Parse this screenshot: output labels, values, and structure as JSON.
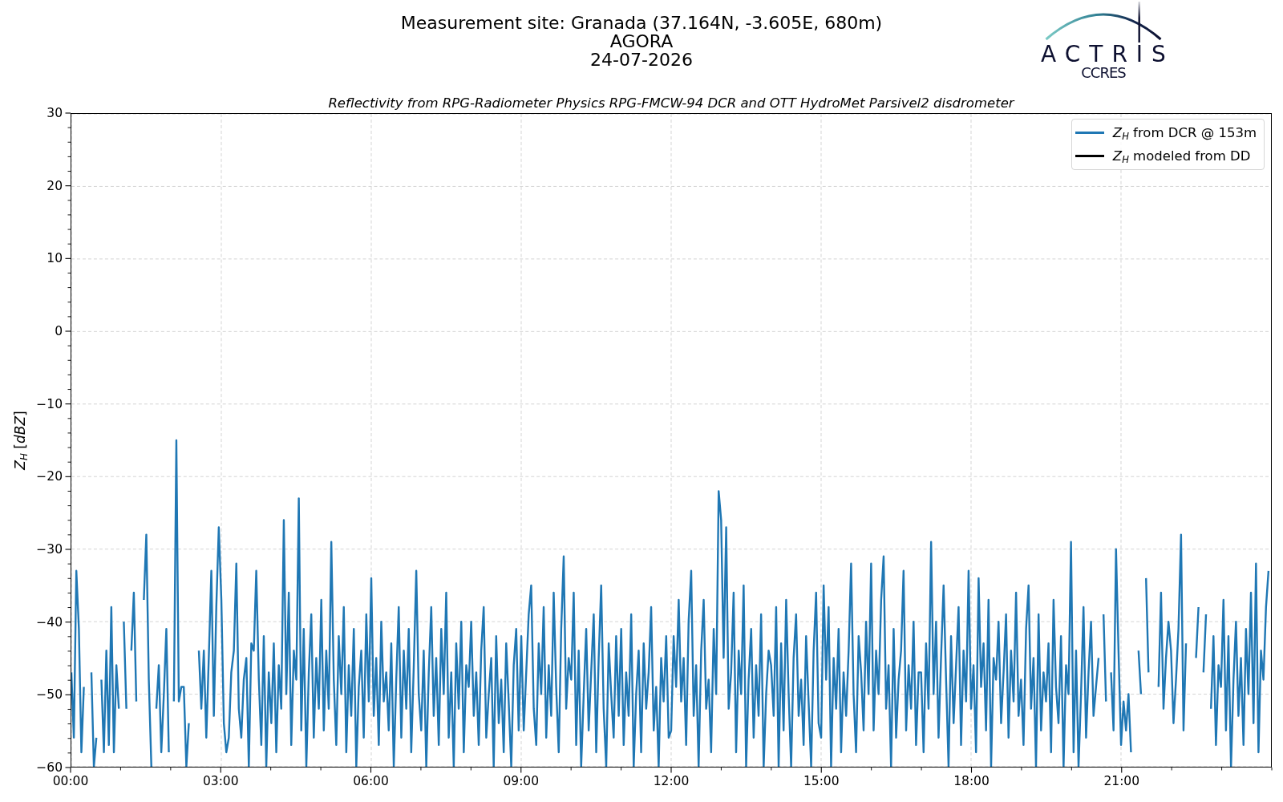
{
  "header": {
    "title": "Measurement site: Granada (37.164N, -3.605E, 680m)",
    "station": "AGORA",
    "date": "24-07-2026"
  },
  "logo": {
    "wordmark": "ACTRIS",
    "subtitle": "CCRES"
  },
  "chart": {
    "chart_data": {
      "type": "line",
      "title": "Reflectivity from RPG-Radiometer Physics RPG-FMCW-94 DCR and OTT HydroMet Parsivel2 disdrometer",
      "ylabel": "*Z*$_{H}$ [*dBZ*]",
      "grid": true,
      "xlim": [
        0,
        1440
      ],
      "ylim": [
        -60,
        30
      ],
      "xticks": [
        {
          "value": 0,
          "label": "00:00"
        },
        {
          "value": 180,
          "label": "03:00"
        },
        {
          "value": 360,
          "label": "06:00"
        },
        {
          "value": 540,
          "label": "09:00"
        },
        {
          "value": 720,
          "label": "12:00"
        },
        {
          "value": 900,
          "label": "15:00"
        },
        {
          "value": 1080,
          "label": "18:00"
        },
        {
          "value": 1260,
          "label": "21:00"
        }
      ],
      "yticks": [
        {
          "value": -60,
          "label": "−60"
        },
        {
          "value": -50,
          "label": "−50"
        },
        {
          "value": -40,
          "label": "−40"
        },
        {
          "value": -30,
          "label": "−30"
        },
        {
          "value": -20,
          "label": "−20"
        },
        {
          "value": -10,
          "label": "−10"
        },
        0,
        10,
        20,
        30
      ],
      "x": [
        0,
        3,
        6,
        9,
        12,
        15,
        24,
        27,
        30,
        36,
        39,
        42,
        45,
        48,
        51,
        54,
        57,
        63,
        66,
        72,
        75,
        78,
        87,
        90,
        93,
        96,
        102,
        105,
        108,
        111,
        114,
        117,
        123,
        126,
        129,
        132,
        135,
        138,
        141,
        153,
        156,
        159,
        162,
        165,
        168,
        171,
        174,
        177,
        180,
        183,
        186,
        189,
        192,
        195,
        198,
        201,
        204,
        207,
        210,
        213,
        216,
        219,
        222,
        225,
        228,
        231,
        234,
        237,
        240,
        243,
        246,
        249,
        252,
        255,
        258,
        261,
        264,
        267,
        270,
        273,
        276,
        279,
        282,
        285,
        288,
        291,
        294,
        297,
        300,
        303,
        306,
        309,
        312,
        315,
        318,
        321,
        324,
        327,
        330,
        333,
        336,
        339,
        342,
        345,
        348,
        351,
        354,
        357,
        360,
        363,
        366,
        369,
        372,
        375,
        378,
        381,
        384,
        387,
        390,
        393,
        396,
        399,
        402,
        405,
        408,
        411,
        414,
        417,
        420,
        423,
        426,
        429,
        432,
        435,
        438,
        441,
        444,
        447,
        450,
        453,
        456,
        459,
        462,
        465,
        468,
        471,
        474,
        477,
        480,
        483,
        486,
        489,
        492,
        495,
        498,
        501,
        504,
        507,
        510,
        513,
        516,
        519,
        522,
        525,
        528,
        531,
        534,
        537,
        540,
        543,
        546,
        549,
        552,
        555,
        558,
        561,
        564,
        567,
        570,
        573,
        576,
        579,
        582,
        585,
        588,
        591,
        594,
        597,
        600,
        603,
        606,
        609,
        612,
        615,
        618,
        621,
        624,
        627,
        630,
        633,
        636,
        639,
        642,
        645,
        648,
        651,
        654,
        657,
        660,
        663,
        666,
        669,
        672,
        675,
        678,
        681,
        684,
        687,
        690,
        693,
        696,
        699,
        702,
        705,
        708,
        711,
        714,
        717,
        720,
        723,
        726,
        729,
        732,
        735,
        738,
        741,
        744,
        747,
        750,
        753,
        756,
        759,
        762,
        765,
        768,
        771,
        774,
        777,
        780,
        783,
        786,
        789,
        792,
        795,
        798,
        801,
        804,
        807,
        810,
        813,
        816,
        819,
        822,
        825,
        828,
        831,
        834,
        837,
        840,
        843,
        846,
        849,
        852,
        855,
        858,
        861,
        864,
        867,
        870,
        873,
        876,
        879,
        882,
        885,
        888,
        891,
        894,
        897,
        900,
        903,
        906,
        909,
        912,
        915,
        918,
        921,
        924,
        927,
        930,
        933,
        936,
        939,
        942,
        945,
        948,
        951,
        954,
        957,
        960,
        963,
        966,
        969,
        972,
        975,
        978,
        981,
        984,
        987,
        990,
        993,
        996,
        999,
        1002,
        1005,
        1008,
        1011,
        1014,
        1017,
        1020,
        1023,
        1026,
        1029,
        1032,
        1035,
        1038,
        1041,
        1044,
        1047,
        1050,
        1053,
        1056,
        1059,
        1062,
        1065,
        1068,
        1071,
        1074,
        1077,
        1080,
        1083,
        1086,
        1089,
        1092,
        1095,
        1098,
        1101,
        1104,
        1107,
        1110,
        1113,
        1116,
        1119,
        1122,
        1125,
        1128,
        1131,
        1134,
        1137,
        1140,
        1143,
        1146,
        1149,
        1152,
        1155,
        1158,
        1161,
        1164,
        1167,
        1170,
        1173,
        1176,
        1179,
        1182,
        1185,
        1188,
        1191,
        1194,
        1197,
        1200,
        1203,
        1206,
        1209,
        1212,
        1215,
        1218,
        1221,
        1224,
        1227,
        1230,
        1233,
        1239,
        1242,
        1248,
        1251,
        1254,
        1257,
        1260,
        1263,
        1266,
        1269,
        1272,
        1281,
        1284,
        1290,
        1293,
        1305,
        1308,
        1311,
        1314,
        1317,
        1320,
        1323,
        1326,
        1329,
        1332,
        1335,
        1338,
        1350,
        1353,
        1359,
        1362,
        1368,
        1371,
        1374,
        1377,
        1380,
        1383,
        1386,
        1389,
        1392,
        1395,
        1398,
        1401,
        1404,
        1407,
        1410,
        1413,
        1416,
        1419,
        1422,
        1425,
        1428,
        1431,
        1434,
        1437
      ],
      "series": [
        {
          "name": "*Z*$_{H}$ from DCR @ 153m",
          "color": "#1f77b4",
          "values": [
            -47,
            -56,
            -33,
            -41,
            -58,
            -49,
            -47,
            -60,
            -56,
            -48,
            -58,
            -44,
            -57,
            -38,
            -58,
            -46,
            -52,
            -40,
            -52,
            -44,
            -36,
            -51,
            -37,
            -28,
            -48,
            -60,
            -52,
            -46,
            -58,
            -50,
            -41,
            -58,
            -51,
            -15,
            -51,
            -49,
            -49,
            -60,
            -54,
            -44,
            -52,
            -44,
            -56,
            -45,
            -33,
            -53,
            -38,
            -27,
            -37,
            -54,
            -58,
            -56,
            -47,
            -44,
            -32,
            -52,
            -56,
            -48,
            -45,
            -60,
            -43,
            -44,
            -33,
            -48,
            -57,
            -42,
            -60,
            -47,
            -54,
            -43,
            -58,
            -46,
            -52,
            -26,
            -50,
            -36,
            -57,
            -44,
            -48,
            -23,
            -55,
            -41,
            -60,
            -47,
            -39,
            -56,
            -45,
            -52,
            -37,
            -55,
            -44,
            -52,
            -29,
            -48,
            -57,
            -42,
            -50,
            -38,
            -58,
            -46,
            -53,
            -41,
            -60,
            -49,
            -44,
            -56,
            -39,
            -51,
            -34,
            -53,
            -45,
            -57,
            -40,
            -51,
            -47,
            -55,
            -43,
            -60,
            -48,
            -38,
            -56,
            -44,
            -52,
            -41,
            -58,
            -46,
            -33,
            -50,
            -55,
            -44,
            -60,
            -47,
            -38,
            -53,
            -45,
            -57,
            -41,
            -50,
            -36,
            -56,
            -47,
            -60,
            -43,
            -52,
            -40,
            -58,
            -46,
            -49,
            -40,
            -53,
            -47,
            -57,
            -44,
            -38,
            -56,
            -50,
            -45,
            -60,
            -42,
            -54,
            -48,
            -58,
            -43,
            -51,
            -60,
            -46,
            -41,
            -55,
            -42,
            -55,
            -47,
            -39,
            -35,
            -52,
            -57,
            -43,
            -50,
            -38,
            -56,
            -46,
            -53,
            -36,
            -49,
            -58,
            -41,
            -31,
            -52,
            -45,
            -48,
            -36,
            -57,
            -44,
            -60,
            -50,
            -41,
            -55,
            -47,
            -39,
            -58,
            -45,
            -35,
            -52,
            -60,
            -43,
            -50,
            -56,
            -42,
            -53,
            -41,
            -57,
            -47,
            -53,
            -39,
            -60,
            -50,
            -44,
            -58,
            -43,
            -52,
            -47,
            -38,
            -55,
            -49,
            -60,
            -45,
            -51,
            -42,
            -56,
            -55,
            -42,
            -49,
            -37,
            -51,
            -45,
            -57,
            -40,
            -33,
            -53,
            -46,
            -60,
            -44,
            -37,
            -52,
            -48,
            -58,
            -41,
            -50,
            -22,
            -26,
            -45,
            -27,
            -52,
            -47,
            -36,
            -58,
            -44,
            -50,
            -35,
            -60,
            -48,
            -41,
            -56,
            -46,
            -53,
            -39,
            -60,
            -50,
            -44,
            -46,
            -53,
            -38,
            -60,
            -43,
            -55,
            -37,
            -50,
            -60,
            -45,
            -39,
            -53,
            -48,
            -57,
            -42,
            -51,
            -60,
            -44,
            -36,
            -54,
            -56,
            -35,
            -48,
            -38,
            -60,
            -45,
            -52,
            -41,
            -58,
            -47,
            -53,
            -44,
            -32,
            -50,
            -58,
            -42,
            -47,
            -55,
            -40,
            -50,
            -32,
            -55,
            -44,
            -50,
            -37,
            -31,
            -52,
            -46,
            -60,
            -41,
            -56,
            -48,
            -44,
            -33,
            -55,
            -46,
            -52,
            -40,
            -57,
            -47,
            -47,
            -58,
            -43,
            -52,
            -29,
            -50,
            -40,
            -56,
            -45,
            -35,
            -48,
            -60,
            -42,
            -54,
            -46,
            -38,
            -57,
            -44,
            -51,
            -33,
            -52,
            -46,
            -58,
            -34,
            -49,
            -43,
            -55,
            -37,
            -60,
            -45,
            -48,
            -40,
            -54,
            -47,
            -39,
            -56,
            -44,
            -51,
            -36,
            -53,
            -48,
            -57,
            -41,
            -35,
            -52,
            -45,
            -60,
            -39,
            -55,
            -47,
            -51,
            -43,
            -58,
            -37,
            -49,
            -54,
            -42,
            -60,
            -46,
            -50,
            -29,
            -58,
            -44,
            -60,
            -50,
            -38,
            -56,
            -47,
            -40,
            -53,
            -49,
            -45,
            -39,
            -51,
            -47,
            -55,
            -30,
            -44,
            -57,
            -51,
            -55,
            -50,
            -58,
            -44,
            -50,
            -34,
            -47,
            -49,
            -36,
            -52,
            -45,
            -40,
            -44,
            -54,
            -48,
            -41,
            -28,
            -55,
            -43,
            -45,
            -38,
            -47,
            -39,
            -52,
            -42,
            -57,
            -46,
            -49,
            -37,
            -55,
            -42,
            -60,
            -48,
            -40,
            -53,
            -45,
            -57,
            -41,
            -50,
            -36,
            -54,
            -32,
            -58,
            -44,
            -48,
            -38,
            -33
          ]
        },
        {
          "name": "*Z*$_{H}$ modeled from DD",
          "color": "#000000",
          "values": [
            null,
            null,
            null,
            null,
            null,
            null,
            null,
            null,
            null,
            null,
            null,
            null,
            null,
            null,
            null,
            null,
            null,
            null,
            null,
            null,
            null,
            null,
            null,
            null,
            null,
            null,
            null,
            null,
            null,
            null,
            null,
            null,
            null,
            null,
            null,
            null,
            null,
            null,
            null,
            null,
            null,
            null,
            null,
            null,
            null,
            null,
            null,
            null,
            null,
            null,
            null,
            null,
            null,
            null,
            null,
            null,
            null,
            null,
            null,
            null,
            null,
            null,
            null,
            null,
            null,
            null,
            null,
            null,
            null,
            null,
            null,
            null,
            null,
            null,
            null,
            null,
            null,
            null,
            null,
            null,
            null,
            null,
            null,
            null,
            null,
            null,
            null,
            null,
            null,
            null,
            null,
            null,
            null,
            null,
            null,
            null,
            null,
            null,
            null,
            null,
            null,
            null,
            null,
            null,
            null,
            null,
            null,
            null,
            null,
            null,
            null,
            null,
            null,
            null,
            null,
            null,
            null,
            null,
            null,
            null,
            null,
            null,
            null,
            null,
            null,
            null,
            null,
            null,
            null,
            null,
            null,
            null,
            null,
            null,
            null,
            null,
            null,
            null,
            null,
            null,
            null,
            null,
            null,
            null,
            null,
            null,
            null,
            null,
            null,
            null,
            null,
            null,
            null,
            null,
            null,
            null,
            null,
            null,
            null,
            null,
            null,
            null,
            null,
            null,
            null,
            null,
            null,
            null,
            null,
            null,
            null,
            null,
            null,
            null,
            null,
            null,
            null,
            null,
            null,
            null,
            null,
            null,
            null,
            null,
            null,
            null,
            null,
            null,
            null,
            null,
            null,
            null,
            null,
            null,
            null,
            null,
            null,
            null,
            null,
            null,
            null,
            null,
            null,
            null,
            null,
            null,
            null,
            null,
            null,
            null,
            null,
            null,
            null,
            null,
            null,
            null,
            null,
            null,
            null,
            null,
            null,
            null,
            null,
            null,
            null,
            null,
            null,
            null,
            null,
            null,
            null,
            null,
            null,
            null,
            null,
            null,
            null,
            null,
            null,
            null,
            null,
            null,
            null,
            null,
            null,
            null,
            null,
            null,
            null,
            null,
            null,
            null,
            null,
            null,
            null,
            null,
            null,
            null,
            null,
            null,
            null,
            null,
            null,
            null,
            null,
            null,
            null,
            null,
            null,
            null,
            null,
            null,
            null,
            null,
            null,
            null,
            null,
            null,
            null,
            null,
            null,
            null,
            null,
            null,
            null,
            null,
            null,
            null,
            null,
            null,
            null,
            null,
            null,
            null,
            null,
            null,
            null,
            null,
            null,
            null,
            null,
            null,
            null,
            null,
            null,
            null,
            null,
            null,
            null,
            null,
            null,
            null,
            null,
            null,
            null,
            null,
            null,
            null,
            null,
            null,
            null,
            null,
            null,
            null,
            null,
            null,
            null,
            null,
            null,
            null,
            null,
            null,
            null,
            null,
            null,
            null,
            null,
            null,
            null,
            null,
            null,
            null,
            null,
            null,
            null,
            null,
            null,
            null,
            null,
            null,
            null,
            null,
            null,
            null,
            null,
            null,
            null,
            null,
            null,
            null,
            null,
            null,
            null,
            null,
            null,
            null,
            null,
            null,
            null,
            null,
            null,
            null,
            null,
            null,
            null,
            null,
            null,
            null,
            null,
            null,
            null,
            null,
            null,
            null,
            null,
            null,
            null,
            null,
            null,
            null,
            null,
            null,
            null,
            null,
            null,
            null,
            null,
            null,
            null,
            null,
            null,
            null,
            null,
            null,
            null,
            null,
            null,
            null,
            null,
            null,
            null,
            null,
            null,
            null,
            null,
            null,
            null,
            null,
            null,
            null,
            null,
            null,
            null,
            null,
            null,
            null,
            null,
            null,
            null,
            null,
            null,
            null,
            null,
            null,
            null,
            null,
            null,
            null,
            null,
            null,
            null,
            null,
            null,
            null,
            null,
            null,
            null,
            null,
            null,
            null,
            null,
            null,
            null,
            null,
            null
          ]
        }
      ]
    }
  }
}
